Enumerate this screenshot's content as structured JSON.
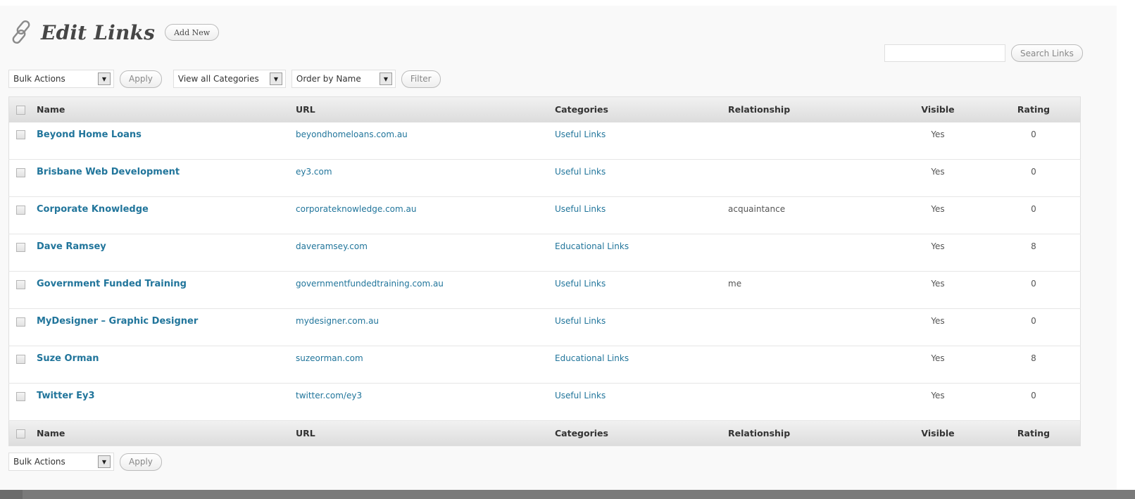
{
  "page": {
    "title": "Edit Links",
    "add_new_label": "Add New"
  },
  "search": {
    "value": "",
    "button_label": "Search Links"
  },
  "toolbar_top": {
    "bulk_actions": "Bulk Actions",
    "apply_label": "Apply",
    "categories_filter": "View all Categories",
    "order_by": "Order by Name",
    "filter_label": "Filter"
  },
  "toolbar_bottom": {
    "bulk_actions": "Bulk Actions",
    "apply_label": "Apply"
  },
  "table": {
    "headers": {
      "name": "Name",
      "url": "URL",
      "categories": "Categories",
      "relationship": "Relationship",
      "visible": "Visible",
      "rating": "Rating"
    },
    "rows": [
      {
        "name": "Beyond Home Loans",
        "url": "beyondhomeloans.com.au",
        "category": "Useful Links",
        "relationship": "",
        "visible": "Yes",
        "rating": "0"
      },
      {
        "name": "Brisbane Web Development",
        "url": "ey3.com",
        "category": "Useful Links",
        "relationship": "",
        "visible": "Yes",
        "rating": "0"
      },
      {
        "name": "Corporate Knowledge",
        "url": "corporateknowledge.com.au",
        "category": "Useful Links",
        "relationship": "acquaintance",
        "visible": "Yes",
        "rating": "0"
      },
      {
        "name": "Dave Ramsey",
        "url": "daveramsey.com",
        "category": "Educational Links",
        "relationship": "",
        "visible": "Yes",
        "rating": "8"
      },
      {
        "name": "Government Funded Training",
        "url": "governmentfundedtraining.com.au",
        "category": "Useful Links",
        "relationship": "me",
        "visible": "Yes",
        "rating": "0"
      },
      {
        "name": "MyDesigner – Graphic Designer",
        "url": "mydesigner.com.au",
        "category": "Useful Links",
        "relationship": "",
        "visible": "Yes",
        "rating": "0"
      },
      {
        "name": "Suze Orman",
        "url": "suzeorman.com",
        "category": "Educational Links",
        "relationship": "",
        "visible": "Yes",
        "rating": "8"
      },
      {
        "name": "Twitter Ey3",
        "url": "twitter.com/ey3",
        "category": "Useful Links",
        "relationship": "",
        "visible": "Yes",
        "rating": "0"
      }
    ]
  },
  "colors": {
    "link": "#21759b",
    "header_bg": "#dcdcdc",
    "page_bg": "#f9f9f9"
  },
  "icons": {
    "header": "link-chain-icon",
    "dropdown": "triangle-down-icon"
  }
}
